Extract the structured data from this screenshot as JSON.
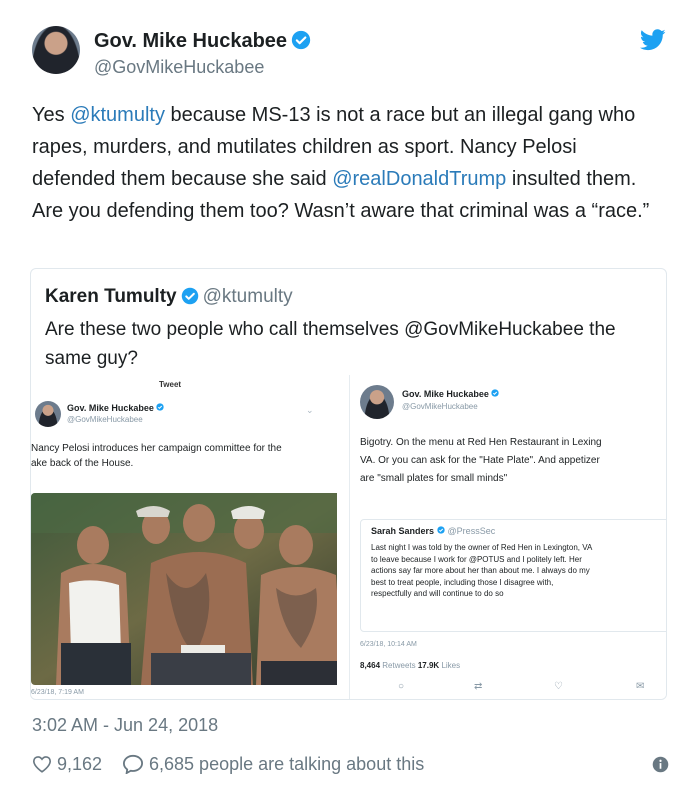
{
  "tweet": {
    "author_name": "Gov. Mike Huckabee",
    "author_handle": "@GovMikeHuckabee",
    "text_parts": {
      "p1": "Yes ",
      "m1": "@ktumulty",
      "p2": " because MS-13 is not a race but an illegal gang who rapes, murders, and mutilates children as sport. Nancy Pelosi defended them because she said ",
      "m2": "@realDonaldTrump",
      "p3": " insulted them. Are you defending them too?  Wasn’t aware that criminal was a “race.”"
    },
    "timestamp": "3:02 AM - Jun 24, 2018",
    "likes": "9,162",
    "talking": "6,685 people are talking about this"
  },
  "quote": {
    "author_name": "Karen Tumulty",
    "author_handle": "@ktumulty",
    "text": "Are these two people who call themselves @GovMikeHuckabee the same guy?"
  },
  "left_shot": {
    "header": "Tweet",
    "name": "Gov. Mike Huckabee",
    "handle": "@GovMikeHuckabee",
    "line1": "Nancy Pelosi introduces her campaign committee for the",
    "line2": "ake back of the House.",
    "time": "6/23/18, 7:19 AM"
  },
  "right_shot": {
    "name": "Gov. Mike Huckabee",
    "handle": "@GovMikeHuckabee",
    "line1": "Bigotry. On the menu at Red Hen Restaurant in Lexing",
    "line2": "VA. Or you can ask for the \"Hate Plate\". And appetizer",
    "line3": "are \"small plates for small minds\"",
    "inner": {
      "name": "Sarah Sanders",
      "handle": "@PressSec",
      "l1": "Last night I was told by the owner of Red Hen in Lexington, VA",
      "l2": "to leave because I work for @POTUS and I politely left. Her",
      "l3": "actions say far more about her than about me. I always do my",
      "l4": "best to treat people, including those I disagree with,",
      "l5": "respectfully and will continue to do so",
      "time": "6/23/18, 10:14 AM"
    },
    "retweets": "8,464",
    "retweets_label": "Retweets",
    "likes": "17.9K",
    "likes_label": "Likes"
  },
  "icons": [
    "verified-badge-icon",
    "twitter-bird-icon",
    "heart-icon",
    "speech-bubble-icon",
    "info-icon",
    "reply-icon",
    "retweet-icon",
    "like-icon",
    "message-icon"
  ],
  "colors": {
    "link": "#2b7bb9",
    "verified": "#1da1f2",
    "muted": "#697882"
  }
}
